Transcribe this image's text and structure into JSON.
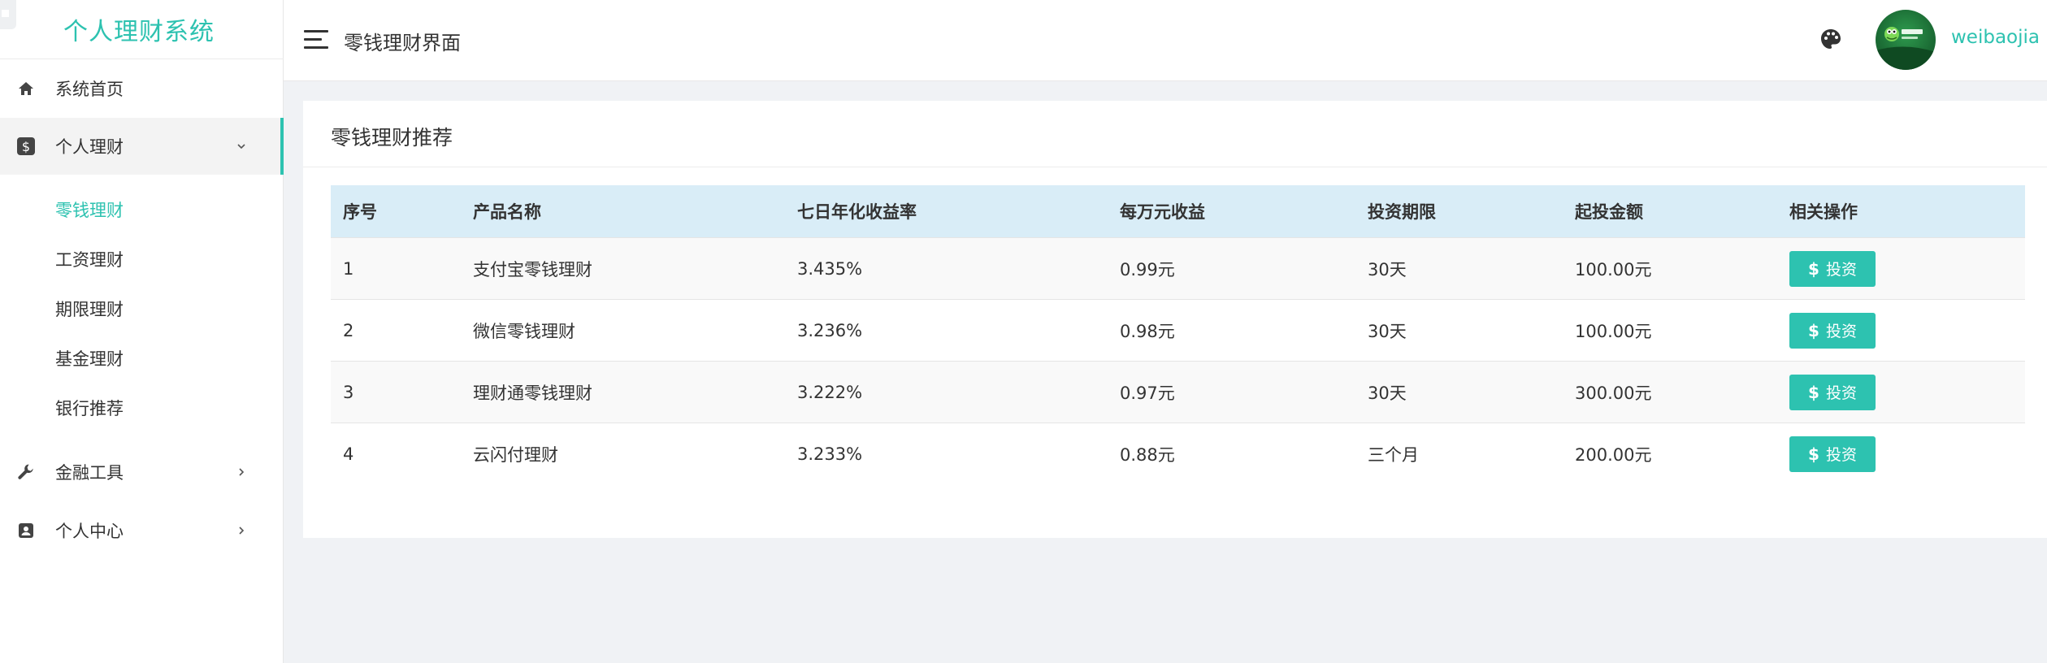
{
  "app": {
    "title": "个人理财系统"
  },
  "sidebar": {
    "items": [
      {
        "label": "系统首页",
        "icon": "home-icon"
      },
      {
        "label": "个人理财",
        "icon": "dollar-icon",
        "expanded": true,
        "children": [
          {
            "label": "零钱理财",
            "active": true
          },
          {
            "label": "工资理财"
          },
          {
            "label": "期限理财"
          },
          {
            "label": "基金理财"
          },
          {
            "label": "银行推荐"
          }
        ]
      },
      {
        "label": "金融工具",
        "icon": "wrench-icon"
      },
      {
        "label": "个人中心",
        "icon": "contact-card-icon"
      }
    ]
  },
  "header": {
    "page_title": "零钱理财界面",
    "username": "weibaojia"
  },
  "card": {
    "title": "零钱理财推荐"
  },
  "table": {
    "columns": [
      "序号",
      "产品名称",
      "七日年化收益率",
      "每万元收益",
      "投资期限",
      "起投金额",
      "相关操作"
    ],
    "rows": [
      [
        "1",
        "支付宝零钱理财",
        "3.435%",
        "0.99元",
        "30天",
        "100.00元"
      ],
      [
        "2",
        "微信零钱理财",
        "3.236%",
        "0.98元",
        "30天",
        "100.00元"
      ],
      [
        "3",
        "理财通零钱理财",
        "3.222%",
        "0.97元",
        "30天",
        "300.00元"
      ],
      [
        "4",
        "云闪付理财",
        "3.233%",
        "0.88元",
        "三个月",
        "200.00元"
      ]
    ],
    "action_label": "投资",
    "action_symbol": "$"
  },
  "colors": {
    "accent": "#2dc2b0",
    "table_header_bg": "#d9edf7",
    "page_bg": "#f0f2f5"
  }
}
